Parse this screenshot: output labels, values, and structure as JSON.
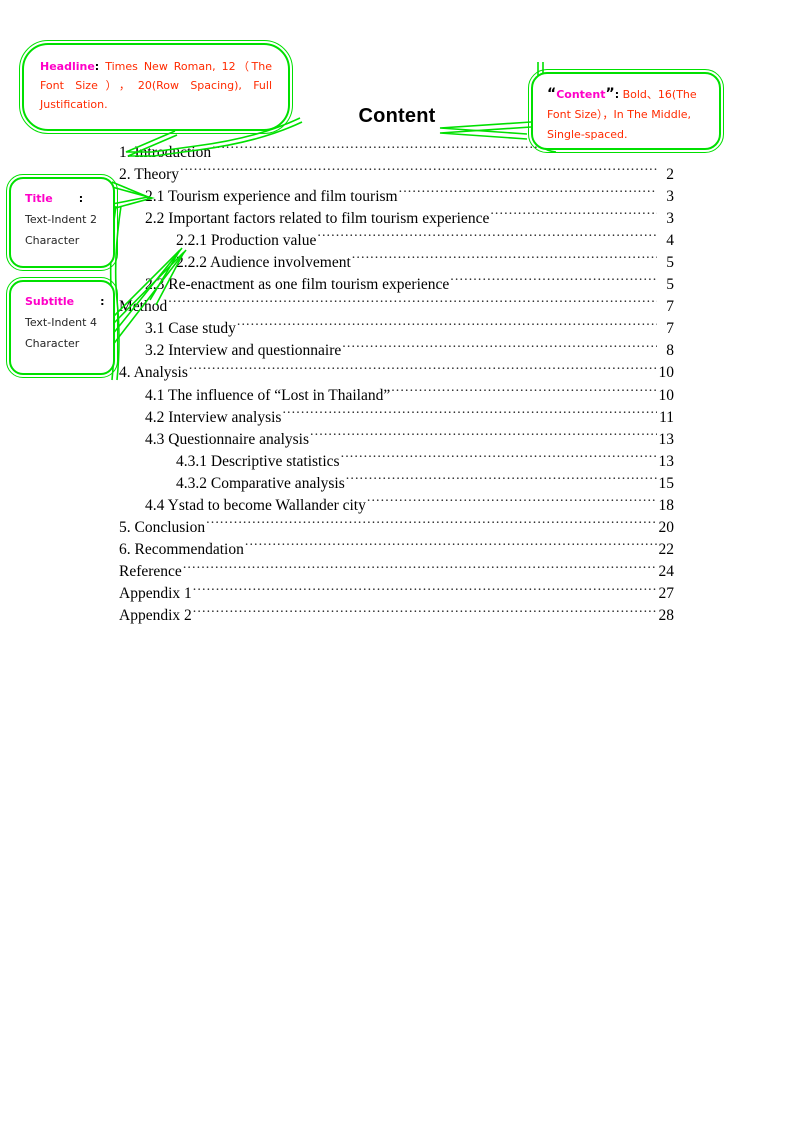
{
  "document": {
    "heading": "Content"
  },
  "annotations": {
    "headline": {
      "keyword": "Headline",
      "colon": ":",
      "body": "Times New Roman, 12（The Font Size），20(Row Spacing), Full Justification."
    },
    "content": {
      "open_quote": "“",
      "keyword": "Content",
      "close_quote": "”",
      "colon": ":",
      "body": "Bold、16(The Font Size），In The Middle, Single-spaced."
    },
    "title": {
      "keyword": "Title",
      "colon": ":",
      "line2": "Text-Indent 2",
      "line3": "Character"
    },
    "subtitle": {
      "keyword": "Subtitle",
      "colon": ":",
      "line2": "Text-Indent 4",
      "line3": "Character"
    }
  },
  "colors": {
    "callout_border": "#00e000",
    "keyword": "#ff00c8",
    "annotation_body": "#ff2a00",
    "text": "#000000"
  },
  "toc": {
    "entries": [
      {
        "label": "1. Introduction",
        "page": "",
        "level": 0
      },
      {
        "label": "2. Theory",
        "page": "2",
        "level": 0
      },
      {
        "label": "2.1 Tourism experience and film tourism",
        "page": "3",
        "level": 1
      },
      {
        "label": "2.2 Important factors related to film tourism experience",
        "page": "3",
        "level": 1
      },
      {
        "label": "2.2.1 Production value",
        "page": "4",
        "level": 2
      },
      {
        "label": "2.2.2 Audience involvement",
        "page": "5",
        "level": 2
      },
      {
        "label": "2.3 Re-enactment as one film tourism experience",
        "page": "5",
        "level": 1
      },
      {
        "label": "Method",
        "page": "7",
        "level": 0
      },
      {
        "label": "3.1 Case study",
        "page": "7",
        "level": 1
      },
      {
        "label": "3.2 Interview and questionnaire",
        "page": "8",
        "level": 1
      },
      {
        "label": "4. Analysis",
        "page": "10",
        "level": 0
      },
      {
        "label": "4.1 The influence of “Lost in Thailand”",
        "page": "10",
        "level": 1
      },
      {
        "label": "4.2 Interview analysis",
        "page": "11",
        "level": 1
      },
      {
        "label": "4.3 Questionnaire analysis",
        "page": "13",
        "level": 1
      },
      {
        "label": "4.3.1 Descriptive statistics",
        "page": "13",
        "level": 2
      },
      {
        "label": "4.3.2 Comparative analysis",
        "page": "15",
        "level": 2
      },
      {
        "label": "4.4 Ystad to become Wallander city",
        "page": "18",
        "level": 1
      },
      {
        "label": "5. Conclusion",
        "page": "20",
        "level": 0
      },
      {
        "label": "6. Recommendation",
        "page": "22",
        "level": 0
      },
      {
        "label": "Reference",
        "page": "24",
        "level": 0
      },
      {
        "label": "Appendix 1",
        "page": "27",
        "level": 0
      },
      {
        "label": "Appendix 2",
        "page": "28",
        "level": 0
      }
    ]
  }
}
